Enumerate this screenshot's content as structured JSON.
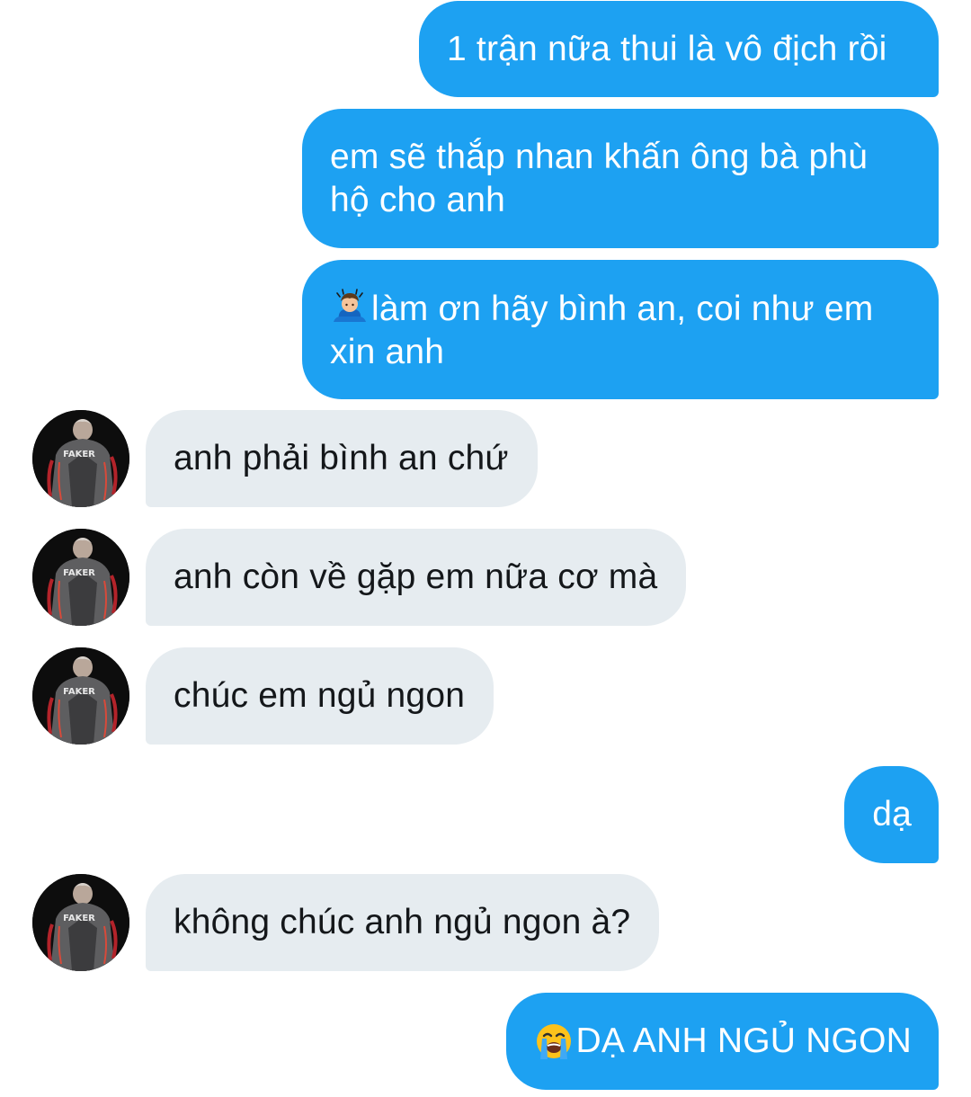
{
  "messages": [
    {
      "dir": "out",
      "text": "1 trận nữa thui là vô địch rồi"
    },
    {
      "dir": "out",
      "text": "em sẽ thắp nhan khấn ông bà phù hộ cho anh"
    },
    {
      "dir": "out",
      "emoji": "person-bowing-emoji",
      "text": "làm ơn hãy bình an, coi như em xin anh"
    },
    {
      "dir": "in",
      "text": "anh phải bình an chứ"
    },
    {
      "dir": "in",
      "text": "anh còn về gặp em nữa cơ mà"
    },
    {
      "dir": "in",
      "text": "chúc em ngủ ngon"
    },
    {
      "dir": "out",
      "text": "dạ"
    },
    {
      "dir": "in",
      "text": "không chúc anh ngủ ngon à?"
    },
    {
      "dir": "out",
      "emoji": "loudly-crying-face-emoji",
      "text": "DẠ ANH NGỦ NGON"
    }
  ],
  "avatar": {
    "jacket_text": "FAKER"
  },
  "colors": {
    "outgoing_bubble": "#1da1f2",
    "outgoing_text": "#ffffff",
    "incoming_bubble": "#e6ecf0",
    "incoming_text": "#14171a",
    "background": "#ffffff"
  }
}
